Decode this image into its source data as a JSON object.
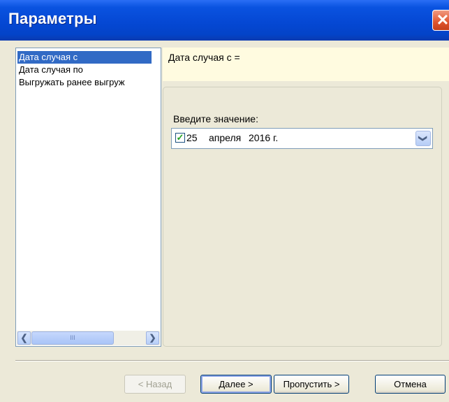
{
  "window": {
    "title": "Параметры",
    "close_symbol": "✕"
  },
  "params_list": {
    "items": [
      {
        "label": "Дата случая с",
        "selected": true
      },
      {
        "label": "Дата случая по",
        "selected": false
      },
      {
        "label": "Выгружать ранее выгруж",
        "selected": false
      }
    ],
    "scroll": {
      "left_arrow": "❮",
      "right_arrow": "❯",
      "thumb_grip": "III"
    }
  },
  "info": {
    "text": "Дата случая с ="
  },
  "value_panel": {
    "prompt": "Введите значение:",
    "checked": true,
    "check_symbol": "✓",
    "date": {
      "day": "25",
      "month": "апреля",
      "year": "2016 г."
    },
    "dropdown_symbol": "❯"
  },
  "buttons": {
    "back": "< Назад",
    "next": "Далее >",
    "skip": "Пропустить >",
    "cancel": "Отмена"
  }
}
